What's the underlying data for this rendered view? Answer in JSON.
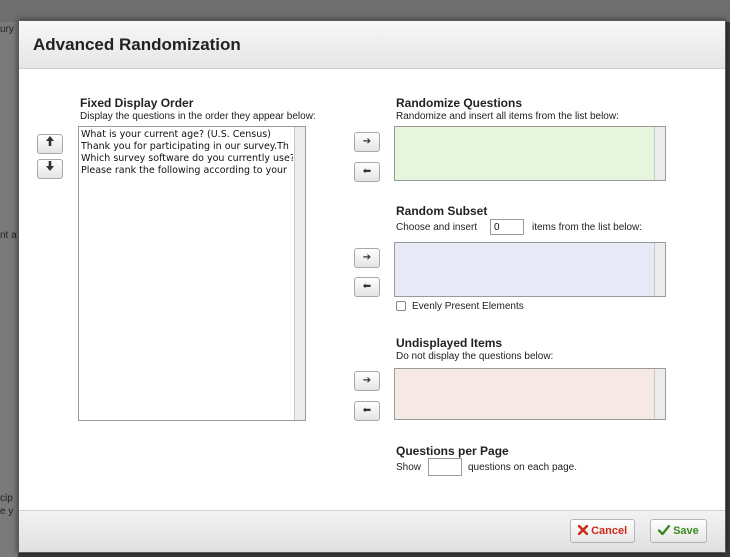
{
  "background": {
    "fragments": [
      "ury",
      "nt a",
      "cip",
      "e y"
    ]
  },
  "dialog": {
    "title": "Advanced Randomization"
  },
  "fixed_order": {
    "title": "Fixed Display Order",
    "description": "Display the questions in the order they appear below:",
    "up_icon": "arrow-up-icon",
    "down_icon": "arrow-down-icon",
    "items": [
      "What is your current age? (U.S. Census)",
      "Thank you for participating in our survey.Th",
      "Which survey software do you currently use?",
      "Please rank the following according to your"
    ]
  },
  "randomize": {
    "title": "Randomize Questions",
    "description": "Randomize and insert all items from the list below:",
    "color": "#e6f5dd"
  },
  "random_subset": {
    "title": "Random Subset",
    "desc_prefix": "Choose and insert",
    "count_value": "0",
    "desc_suffix": "items from the list below:",
    "checkbox_label": "Evenly Present Elements",
    "checked": false,
    "color": "#e8e9f6"
  },
  "undisplayed": {
    "title": "Undisplayed Items",
    "description": "Do not display the questions below:",
    "color": "#f6e8e4"
  },
  "per_page": {
    "title": "Questions per Page",
    "prefix": "Show",
    "value": "",
    "suffix": "questions on each page."
  },
  "arrows": {
    "right": "➔",
    "left": "⬅"
  },
  "footer": {
    "cancel_label": "Cancel",
    "save_label": "Save",
    "cancel_color": "#cc2a1a",
    "save_color": "#3c8a1f"
  }
}
